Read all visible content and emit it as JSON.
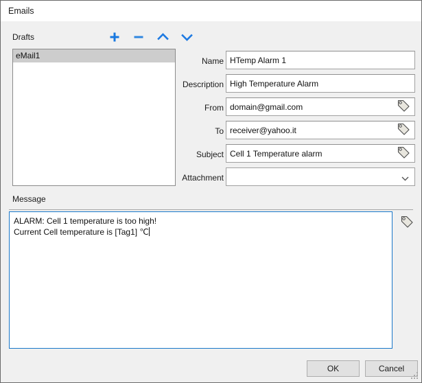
{
  "window": {
    "title": "Emails"
  },
  "drafts": {
    "label": "Drafts",
    "toolbar": [
      {
        "name": "add-draft-button",
        "icon": "plus-icon"
      },
      {
        "name": "remove-draft-button",
        "icon": "minus-icon"
      },
      {
        "name": "move-up-button",
        "icon": "chevron-up-icon"
      },
      {
        "name": "move-down-button",
        "icon": "chevron-down-icon"
      }
    ],
    "items": [
      {
        "label": "eMail1",
        "selected": true
      }
    ]
  },
  "form": {
    "fields": [
      {
        "label": "Name",
        "value": "HTemp Alarm 1",
        "tag_picker": false
      },
      {
        "label": "Description",
        "value": "High Temperature Alarm",
        "tag_picker": false
      },
      {
        "label": "From",
        "value": "domain@gmail.com",
        "tag_picker": true
      },
      {
        "label": "To",
        "value": "receiver@yahoo.it",
        "tag_picker": true
      },
      {
        "label": "Subject",
        "value": "Cell 1 Temperature alarm",
        "tag_picker": true
      }
    ],
    "attachment": {
      "label": "Attachment",
      "value": "",
      "options": []
    }
  },
  "message": {
    "label": "Message",
    "line1": "ALARM: Cell 1 temperature is too high!",
    "line2": "Current Cell temperature is [Tag1] ℃",
    "tag_picker_name": "tag-picker-icon"
  },
  "footer": {
    "ok_label": "OK",
    "cancel_label": "Cancel"
  },
  "colors": {
    "accent_blue": "#1878e0",
    "focus_border": "#1876c8",
    "dialog_bg": "#f0f0f0",
    "selection_gray": "#cdcdcd"
  }
}
